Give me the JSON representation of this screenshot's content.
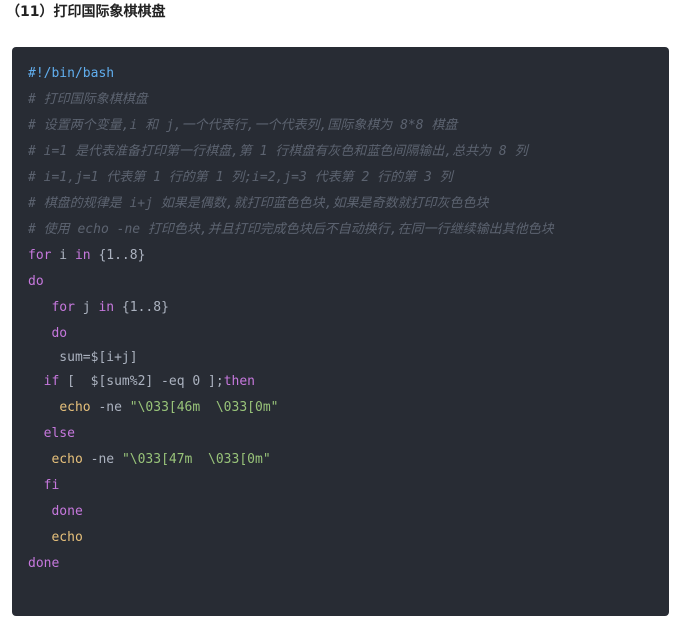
{
  "heading": "（11）打印国际象棋棋盘",
  "code": {
    "shebang": "#!/bin/bash",
    "comments": [
      "# 打印国际象棋棋盘",
      "# 设置两个变量,i 和 j,一个代表行,一个代表列,国际象棋为 8*8 棋盘",
      "# i=1 是代表准备打印第一行棋盘,第 1 行棋盘有灰色和蓝色间隔输出,总共为 8 列",
      "# i=1,j=1 代表第 1 行的第 1 列;i=2,j=3 代表第 2 行的第 3 列",
      "# 棋盘的规律是 i+j 如果是偶数,就打印蓝色色块,如果是奇数就打印灰色色块",
      "# 使用 echo -ne 打印色块,并且打印完成色块后不自动换行,在同一行继续输出其他色块"
    ],
    "for_outer": {
      "kw1": "for",
      "mid": " i ",
      "kw2": "in",
      "rest": " {1..8}"
    },
    "do_outer": "do",
    "for_inner": {
      "indent": "   ",
      "kw1": "for",
      "mid": " j ",
      "kw2": "in",
      "rest": " {1..8}"
    },
    "do_inner": {
      "indent": "   ",
      "kw": "do"
    },
    "sum_line": "    sum=$[i+j]",
    "if_line": {
      "indent": "  ",
      "kw": "if",
      "rest": " [  $[sum%2] -eq 0 ];",
      "then": "then"
    },
    "echo1": {
      "indent": "    ",
      "cmd": "echo",
      "flag": " -ne ",
      "str": "\"\\033[46m  \\033[0m\""
    },
    "else_line": {
      "indent": "  ",
      "kw": "else"
    },
    "echo2": {
      "indent": "   ",
      "cmd": "echo",
      "flag": " -ne ",
      "str": "\"\\033[47m  \\033[0m\""
    },
    "fi_line": {
      "indent": "  ",
      "kw": "fi"
    },
    "done_inner": {
      "indent": "   ",
      "kw": "done"
    },
    "echo3": {
      "indent": "   ",
      "cmd": "echo"
    },
    "done_outer": "done"
  },
  "colors": {
    "background": "#282c34",
    "comment": "#5c6370",
    "keyword": "#c678dd",
    "builtin": "#e6c07b",
    "string": "#98c379",
    "shebang": "#61aeee",
    "plain": "#abb2bf"
  }
}
